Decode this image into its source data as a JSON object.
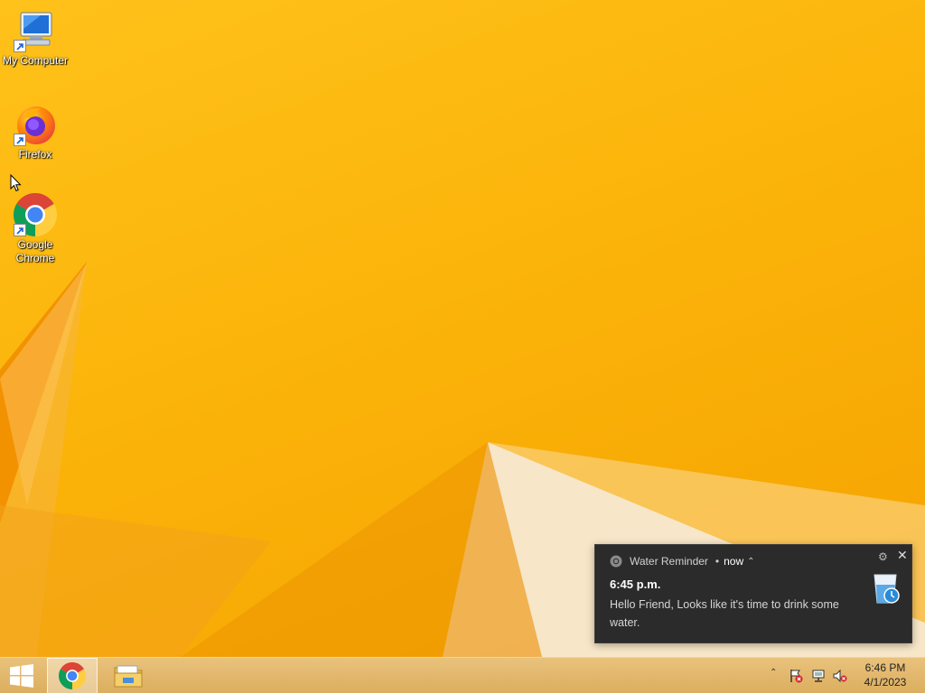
{
  "desktop": {
    "icons": [
      {
        "label": "My Computer",
        "icon": "computer-icon"
      },
      {
        "label": "Firefox",
        "icon": "firefox-icon"
      },
      {
        "label": "Google Chrome",
        "icon": "chrome-icon"
      }
    ]
  },
  "notification": {
    "app_name": "Water Reminder",
    "separator": "•",
    "time": "now",
    "expand_glyph": "⌃",
    "title": "6:45 p.m.",
    "body": "Hello Friend, Looks like  it's time to drink some water.",
    "settings_glyph": "⚙",
    "close_glyph": "✕"
  },
  "taskbar": {
    "buttons": [
      {
        "name": "start",
        "icon": "windows-logo-icon"
      },
      {
        "name": "chrome",
        "icon": "chrome-icon"
      },
      {
        "name": "file-explorer",
        "icon": "folder-icon"
      }
    ],
    "tray": {
      "overflow_glyph": "⌃",
      "icons": [
        "action-center-flag-icon",
        "network-icon",
        "volume-muted-icon"
      ]
    },
    "clock": {
      "time": "6:46 PM",
      "date": "4/1/2023"
    }
  },
  "colors": {
    "wallpaper": "#f8b400",
    "toast_bg": "#2b2b2b",
    "taskbar_bg": "#e0b466"
  }
}
